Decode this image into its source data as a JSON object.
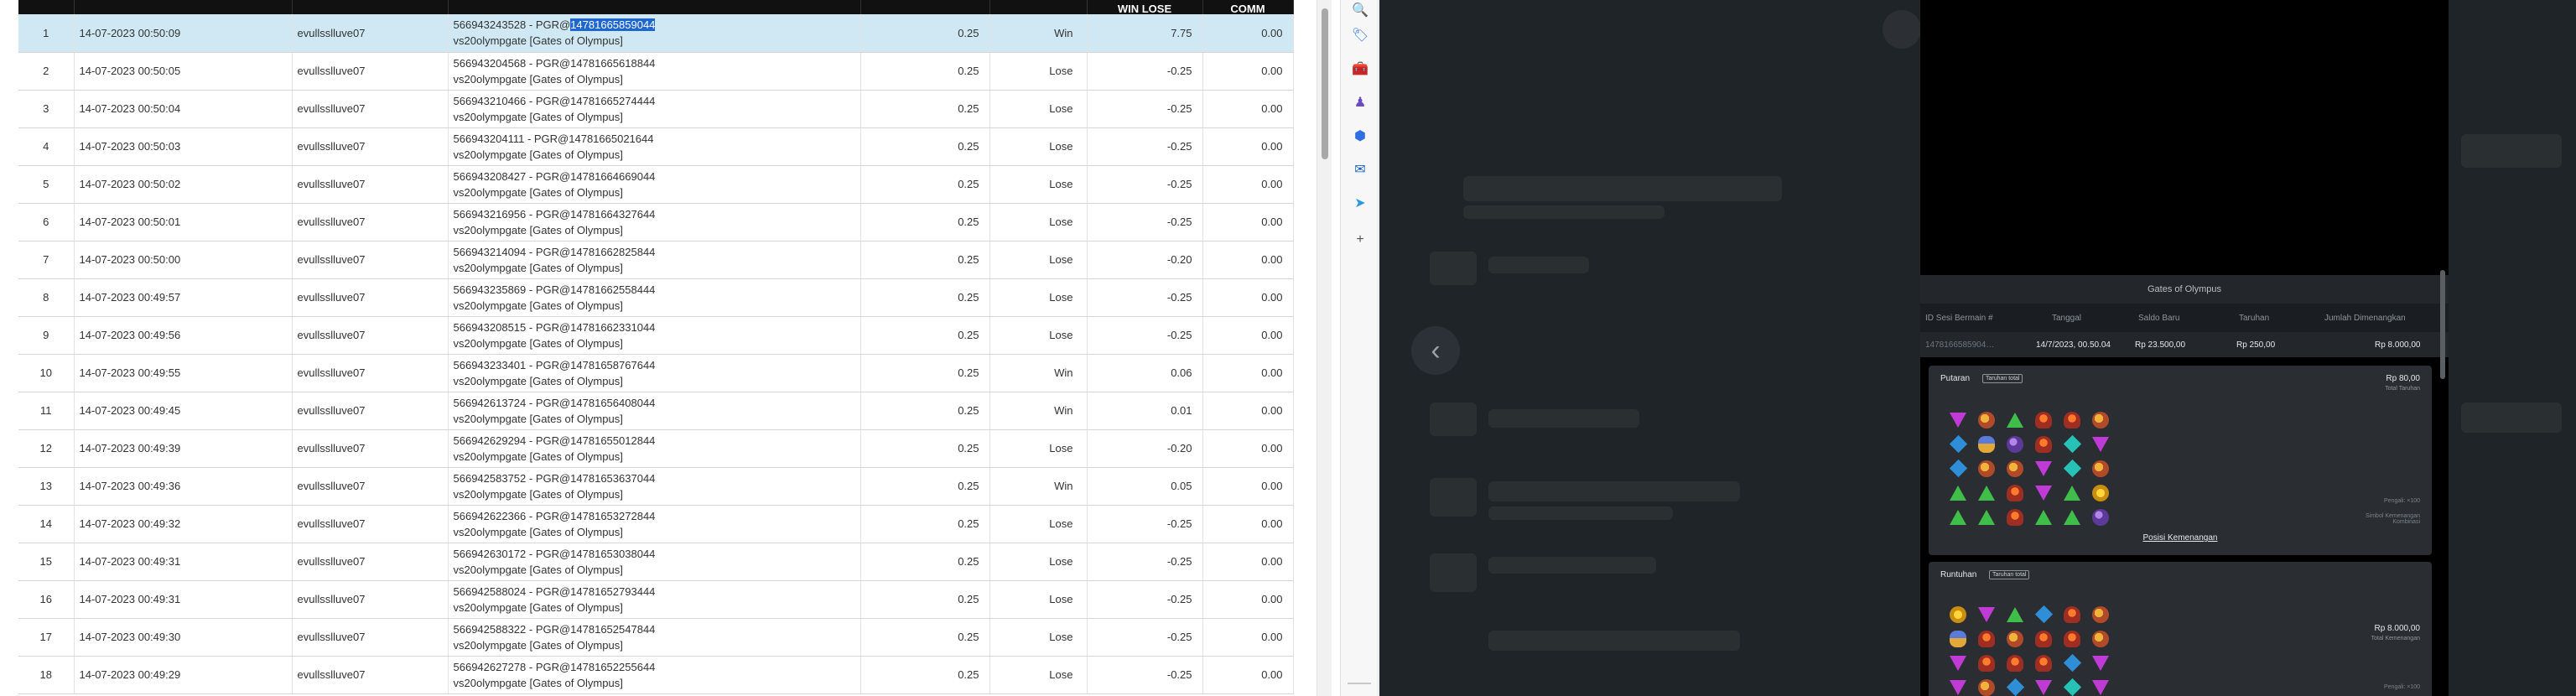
{
  "table": {
    "headers": [
      "",
      "",
      "",
      "",
      "",
      "",
      "WIN LOSE",
      "COMM"
    ],
    "rows": [
      {
        "no": "1",
        "date": "14-07-2023 00:50:09",
        "user": "evullsslluve07",
        "ref_pre": "566943243528 - PGR@",
        "ref_hl": "14781665859044",
        "game": "vs20olympgate [Gates of Olympus]",
        "bet": "0.25",
        "result": "Win",
        "winlose": "7.75",
        "comm": "0.00"
      },
      {
        "no": "2",
        "date": "14-07-2023 00:50:05",
        "user": "evullsslluve07",
        "ref_pre": "566943204568 - PGR@14781665618844",
        "ref_hl": "",
        "game": "vs20olympgate [Gates of Olympus]",
        "bet": "0.25",
        "result": "Lose",
        "winlose": "-0.25",
        "comm": "0.00"
      },
      {
        "no": "3",
        "date": "14-07-2023 00:50:04",
        "user": "evullsslluve07",
        "ref_pre": "566943210466 - PGR@14781665274444",
        "ref_hl": "",
        "game": "vs20olympgate [Gates of Olympus]",
        "bet": "0.25",
        "result": "Lose",
        "winlose": "-0.25",
        "comm": "0.00"
      },
      {
        "no": "4",
        "date": "14-07-2023 00:50:03",
        "user": "evullsslluve07",
        "ref_pre": "566943204111 - PGR@14781665021644",
        "ref_hl": "",
        "game": "vs20olympgate [Gates of Olympus]",
        "bet": "0.25",
        "result": "Lose",
        "winlose": "-0.25",
        "comm": "0.00"
      },
      {
        "no": "5",
        "date": "14-07-2023 00:50:02",
        "user": "evullsslluve07",
        "ref_pre": "566943208427 - PGR@14781664669044",
        "ref_hl": "",
        "game": "vs20olympgate [Gates of Olympus]",
        "bet": "0.25",
        "result": "Lose",
        "winlose": "-0.25",
        "comm": "0.00"
      },
      {
        "no": "6",
        "date": "14-07-2023 00:50:01",
        "user": "evullsslluve07",
        "ref_pre": "566943216956 - PGR@14781664327644",
        "ref_hl": "",
        "game": "vs20olympgate [Gates of Olympus]",
        "bet": "0.25",
        "result": "Lose",
        "winlose": "-0.25",
        "comm": "0.00"
      },
      {
        "no": "7",
        "date": "14-07-2023 00:50:00",
        "user": "evullsslluve07",
        "ref_pre": "566943214094 - PGR@14781662825844",
        "ref_hl": "",
        "game": "vs20olympgate [Gates of Olympus]",
        "bet": "0.25",
        "result": "Lose",
        "winlose": "-0.20",
        "comm": "0.00"
      },
      {
        "no": "8",
        "date": "14-07-2023 00:49:57",
        "user": "evullsslluve07",
        "ref_pre": "566943235869 - PGR@14781662558444",
        "ref_hl": "",
        "game": "vs20olympgate [Gates of Olympus]",
        "bet": "0.25",
        "result": "Lose",
        "winlose": "-0.25",
        "comm": "0.00"
      },
      {
        "no": "9",
        "date": "14-07-2023 00:49:56",
        "user": "evullsslluve07",
        "ref_pre": "566943208515 - PGR@14781662331044",
        "ref_hl": "",
        "game": "vs20olympgate [Gates of Olympus]",
        "bet": "0.25",
        "result": "Lose",
        "winlose": "-0.25",
        "comm": "0.00"
      },
      {
        "no": "10",
        "date": "14-07-2023 00:49:55",
        "user": "evullsslluve07",
        "ref_pre": "566943233401 - PGR@14781658767644",
        "ref_hl": "",
        "game": "vs20olympgate [Gates of Olympus]",
        "bet": "0.25",
        "result": "Win",
        "winlose": "0.06",
        "comm": "0.00"
      },
      {
        "no": "11",
        "date": "14-07-2023 00:49:45",
        "user": "evullsslluve07",
        "ref_pre": "566942613724 - PGR@14781656408044",
        "ref_hl": "",
        "game": "vs20olympgate [Gates of Olympus]",
        "bet": "0.25",
        "result": "Win",
        "winlose": "0.01",
        "comm": "0.00"
      },
      {
        "no": "12",
        "date": "14-07-2023 00:49:39",
        "user": "evullsslluve07",
        "ref_pre": "566942629294 - PGR@14781655012844",
        "ref_hl": "",
        "game": "vs20olympgate [Gates of Olympus]",
        "bet": "0.25",
        "result": "Lose",
        "winlose": "-0.20",
        "comm": "0.00"
      },
      {
        "no": "13",
        "date": "14-07-2023 00:49:36",
        "user": "evullsslluve07",
        "ref_pre": "566942583752 - PGR@14781653637044",
        "ref_hl": "",
        "game": "vs20olympgate [Gates of Olympus]",
        "bet": "0.25",
        "result": "Win",
        "winlose": "0.05",
        "comm": "0.00"
      },
      {
        "no": "14",
        "date": "14-07-2023 00:49:32",
        "user": "evullsslluve07",
        "ref_pre": "566942622366 - PGR@14781653272844",
        "ref_hl": "",
        "game": "vs20olympgate [Gates of Olympus]",
        "bet": "0.25",
        "result": "Lose",
        "winlose": "-0.25",
        "comm": "0.00"
      },
      {
        "no": "15",
        "date": "14-07-2023 00:49:31",
        "user": "evullsslluve07",
        "ref_pre": "566942630172 - PGR@14781653038044",
        "ref_hl": "",
        "game": "vs20olympgate [Gates of Olympus]",
        "bet": "0.25",
        "result": "Lose",
        "winlose": "-0.25",
        "comm": "0.00"
      },
      {
        "no": "16",
        "date": "14-07-2023 00:49:31",
        "user": "evullsslluve07",
        "ref_pre": "566942588024 - PGR@14781652793444",
        "ref_hl": "",
        "game": "vs20olympgate [Gates of Olympus]",
        "bet": "0.25",
        "result": "Lose",
        "winlose": "-0.25",
        "comm": "0.00"
      },
      {
        "no": "17",
        "date": "14-07-2023 00:49:30",
        "user": "evullsslluve07",
        "ref_pre": "566942588322 - PGR@14781652547844",
        "ref_hl": "",
        "game": "vs20olympgate [Gates of Olympus]",
        "bet": "0.25",
        "result": "Lose",
        "winlose": "-0.25",
        "comm": "0.00"
      },
      {
        "no": "18",
        "date": "14-07-2023 00:49:29",
        "user": "evullsslluve07",
        "ref_pre": "566942627278 - PGR@14781652255644",
        "ref_hl": "",
        "game": "vs20olympgate [Gates of Olympus]",
        "bet": "0.25",
        "result": "Lose",
        "winlose": "-0.25",
        "comm": "0.00"
      }
    ]
  },
  "sidebar": {
    "icons": [
      {
        "name": "search-icon",
        "glyph": "🔍",
        "color": "#5b6ad0"
      },
      {
        "name": "tag-icon",
        "glyph": "🏷",
        "color": "#3a7be0"
      },
      {
        "name": "toolbox-icon",
        "glyph": "🧰",
        "color": "#d9462f"
      },
      {
        "name": "person-chess-icon",
        "glyph": "♟",
        "color": "#6a4bc4"
      },
      {
        "name": "copilot-icon",
        "glyph": "⬢",
        "color": "#2f6fe0"
      },
      {
        "name": "outlook-icon",
        "glyph": "✉",
        "color": "#1565c0"
      },
      {
        "name": "send-icon",
        "glyph": "➤",
        "color": "#2a9adf"
      },
      {
        "name": "plus-icon",
        "glyph": "+",
        "color": "#555555"
      }
    ]
  },
  "history": {
    "title": "Gates of Olympus",
    "columns": [
      "ID Sesi Bermain #",
      "Tanggal",
      "Saldo Baru",
      "Taruhan",
      "Jumlah Dimenangkan"
    ],
    "values": [
      "1478166585904…",
      "14/7/2023, 00.50.04",
      "Rp 23.500,00",
      "Rp 250,00",
      "Rp 8.000,00"
    ],
    "spin": {
      "title": "Putaran",
      "tag": "Taruhan total",
      "amount": "Rp 80,00",
      "amount_sub": "Total Taruhan",
      "side1": "Pengali: ×100",
      "side2": "Simbol Kemenangan\nKombinasi",
      "link": "Posisi Kemenangan"
    },
    "tumble": {
      "title": "Runtuhan",
      "tag": "Taruhan total",
      "amount": "Rp 8.000,00",
      "amount_sub": "Total Kemenangan",
      "side1": "Pengali: ×100"
    },
    "grid1": [
      "s-tri-purple",
      "s-ring",
      "s-tri-green",
      "s-cup",
      "s-cup",
      "s-ring",
      "s-dia-blue",
      "s-hour",
      "s-orb",
      "s-cup",
      "s-dia-teal",
      "s-tri-purple",
      "s-dia-blue",
      "s-ring",
      "s-ring",
      "s-tri-purple",
      "s-dia-teal",
      "s-ring",
      "s-tri-green",
      "s-tri-green",
      "s-cup",
      "s-tri-purple",
      "s-tri-green",
      "s-crown",
      "s-tri-green",
      "s-tri-green",
      "s-cup",
      "s-tri-green",
      "s-tri-green",
      "s-orb"
    ],
    "grid2": [
      "s-crown",
      "s-tri-purple",
      "s-tri-green",
      "s-dia-blue",
      "s-cup",
      "s-ring",
      "s-hour",
      "s-cup",
      "s-ring",
      "s-cup",
      "s-cup",
      "s-ring",
      "s-tri-purple",
      "s-cup",
      "s-cup",
      "s-cup",
      "s-dia-blue",
      "s-tri-purple",
      "s-tri-purple",
      "s-ring",
      "s-dia-blue",
      "s-tri-purple",
      "s-dia-teal",
      "s-tri-purple"
    ]
  }
}
